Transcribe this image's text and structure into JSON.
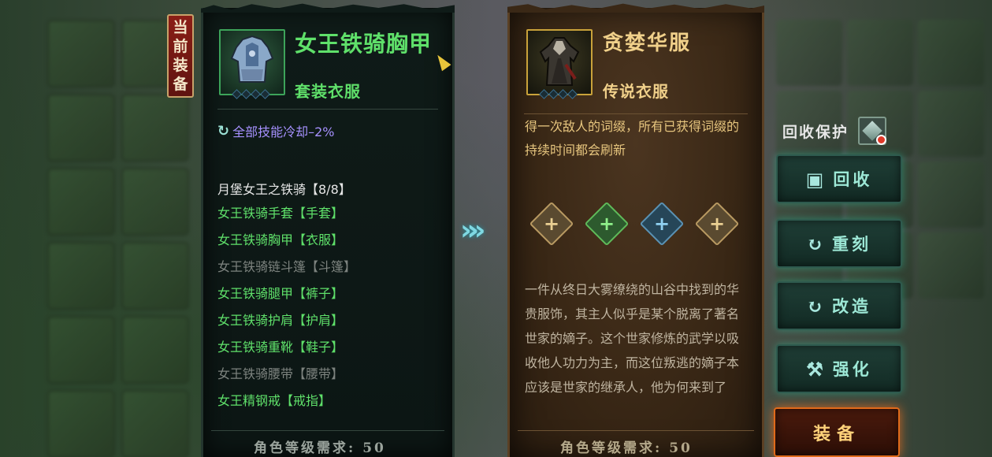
{
  "current_tag": [
    "当",
    "前",
    "装",
    "备"
  ],
  "current_item": {
    "name": "女王铁骑胸甲",
    "type": "套装衣服",
    "stat": "全部技能冷却–2%",
    "set_title": "月堡女王之铁骑【8/8】",
    "set_pieces": [
      {
        "text": "女王铁骑手套【手套】",
        "active": true
      },
      {
        "text": "女王铁骑胸甲【衣服】",
        "active": true
      },
      {
        "text": "女王铁骑链斗篷【斗篷】",
        "active": false
      },
      {
        "text": "女王铁骑腿甲【裤子】",
        "active": true
      },
      {
        "text": "女王铁骑护肩【护肩】",
        "active": true
      },
      {
        "text": "女王铁骑重靴【鞋子】",
        "active": true
      },
      {
        "text": "女王铁骑腰带【腰带】",
        "active": false
      },
      {
        "text": "女王精钢戒【戒指】",
        "active": true
      }
    ],
    "requirement": "角色等级需求: 50"
  },
  "new_item": {
    "name": "贪婪华服",
    "type": "传说衣服",
    "affix": "得一次敌人的词缀，所有已获得词缀的持续时间都会刷新",
    "sockets": [
      "+",
      "+",
      "+",
      "+"
    ],
    "lore": "一件从终日大雾缭绕的山谷中找到的华贵服饰，其主人似乎是某个脱离了著名世家的嫡子。这个世家修炼的武学以吸收他人功力为主，而这位叛逃的嫡子本应该是世家的继承人，他为何来到了",
    "requirement": "角色等级需求: 50"
  },
  "actions": {
    "protect_label": "回收保护",
    "recycle": "回收",
    "reforge": "重刻",
    "modify": "改造",
    "enhance": "强化",
    "equip": "装备"
  },
  "icons": {
    "recycle": "cube-icon",
    "reforge": "refresh-icon",
    "modify": "refresh-icon",
    "enhance": "hammer-icon"
  },
  "colors": {
    "set_green": "#5fe06a",
    "legend_gold": "#f0d08a",
    "stat_purple": "#a691ff",
    "button_teal": "#9de8d6",
    "equip_orange": "#e06a1a"
  }
}
